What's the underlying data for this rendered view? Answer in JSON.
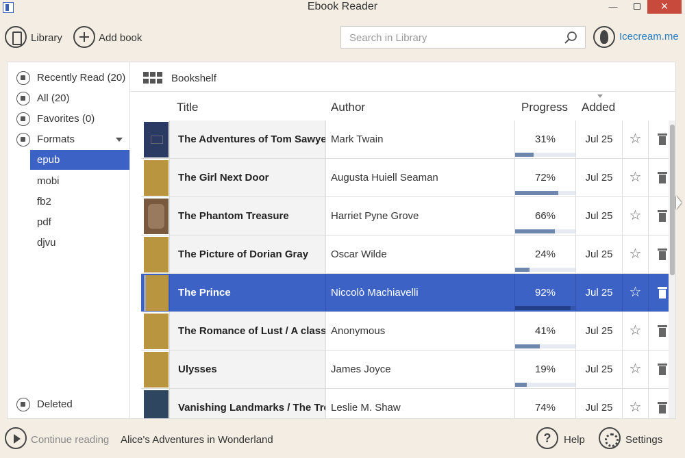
{
  "window": {
    "title": "Ebook Reader",
    "minimize": "—",
    "close": "×"
  },
  "toolbar": {
    "library_label": "Library",
    "add_book_label": "Add book",
    "search_placeholder": "Search in Library",
    "brand_link": "Icecream.me"
  },
  "sidebar": {
    "items": [
      {
        "label": "Recently Read (20)",
        "icon": "recent-icon"
      },
      {
        "label": "All (20)",
        "icon": "all-books-icon"
      },
      {
        "label": "Favorites (0)",
        "icon": "star-icon"
      },
      {
        "label": "Formats",
        "icon": "formats-icon"
      }
    ],
    "formats": [
      "epub",
      "mobi",
      "fb2",
      "pdf",
      "djvu"
    ],
    "selected_format": "epub",
    "deleted_label": "Deleted"
  },
  "main": {
    "view_title": "Bookshelf",
    "columns": {
      "title": "Title",
      "author": "Author",
      "progress": "Progress",
      "added": "Added"
    },
    "sorted_column": "Added",
    "rows": [
      {
        "title": "The Adventures of Tom Sawyer",
        "author": "Mark Twain",
        "progress": "31%",
        "progress_value": 0.31,
        "added": "Jul 25",
        "cover": "navy",
        "selected": false
      },
      {
        "title": "The Girl Next Door",
        "author": "Augusta Huiell Seaman",
        "progress": "72%",
        "progress_value": 0.72,
        "added": "Jul 25",
        "cover": "gold",
        "selected": false
      },
      {
        "title": "The Phantom Treasure",
        "author": "Harriet Pyne Grove",
        "progress": "66%",
        "progress_value": 0.66,
        "added": "Jul 25",
        "cover": "brown",
        "selected": false
      },
      {
        "title": "The Picture of Dorian Gray",
        "author": "Oscar Wilde",
        "progress": "24%",
        "progress_value": 0.24,
        "added": "Jul 25",
        "cover": "gold",
        "selected": false
      },
      {
        "title": "The Prince",
        "author": "Niccolò Machiavelli",
        "progress": "92%",
        "progress_value": 0.92,
        "added": "Jul 25",
        "cover": "gold",
        "selected": true
      },
      {
        "title": "The Romance of Lust / A classic",
        "author": "Anonymous",
        "progress": "41%",
        "progress_value": 0.41,
        "added": "Jul 25",
        "cover": "gold",
        "selected": false
      },
      {
        "title": "Ulysses",
        "author": "James Joyce",
        "progress": "19%",
        "progress_value": 0.19,
        "added": "Jul 25",
        "cover": "gold",
        "selected": false
      },
      {
        "title": "Vanishing Landmarks / The Trend",
        "author": "Leslie M. Shaw",
        "progress": "74%",
        "progress_value": 0.74,
        "added": "Jul 25",
        "cover": "slate",
        "selected": false
      }
    ]
  },
  "footer": {
    "continue_label": "Continue reading",
    "continue_book": "Alice's Adventures in Wonderland",
    "help_label": "Help",
    "settings_label": "Settings"
  },
  "colors": {
    "accent": "#3b62c4",
    "background": "#f3ede3",
    "close_button": "#c84a3c",
    "link": "#2a7dc0",
    "progress_fill": "#6f86ae"
  }
}
